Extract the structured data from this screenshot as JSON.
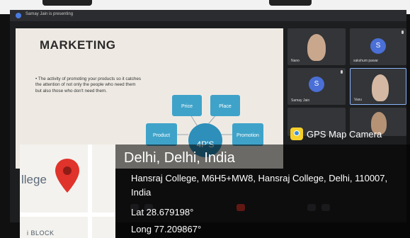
{
  "meeting": {
    "presenting_text": "Samay Jain is presenting"
  },
  "slide": {
    "heading": "MARKETING",
    "bullet": "• The activity of promoting your products so it catches the attention of not only the people who need them but also those who don't need them.",
    "center_label": "4P'S",
    "boxes": [
      "Price",
      "Place",
      "Product",
      "Promotion"
    ]
  },
  "participants": [
    {
      "name": "Nano",
      "kind": "person"
    },
    {
      "name": "sakshum pawar",
      "kind": "avatar",
      "initial": "S"
    },
    {
      "name": "Samay Jain",
      "kind": "avatar",
      "initial": "S"
    },
    {
      "name": "Vasu",
      "kind": "person"
    }
  ],
  "overlay": {
    "badge_icon": "gps-map-camera-icon",
    "badge_label": "GPS Map Camera",
    "map_place_label": "llege",
    "map_block_label": "i BLOCK",
    "city": "Delhi, Delhi, India",
    "address": "Hansraj College, M6H5+MW8, Hansraj College, Delhi, 110007, India",
    "lat": "Lat 28.679198°",
    "long": "Long 77.209867°"
  },
  "colors": {
    "slide_box": "#3fa3c9",
    "slide_center": "#2d8fba",
    "avatar": "#4a6fd6",
    "pin": "#e0332b"
  }
}
